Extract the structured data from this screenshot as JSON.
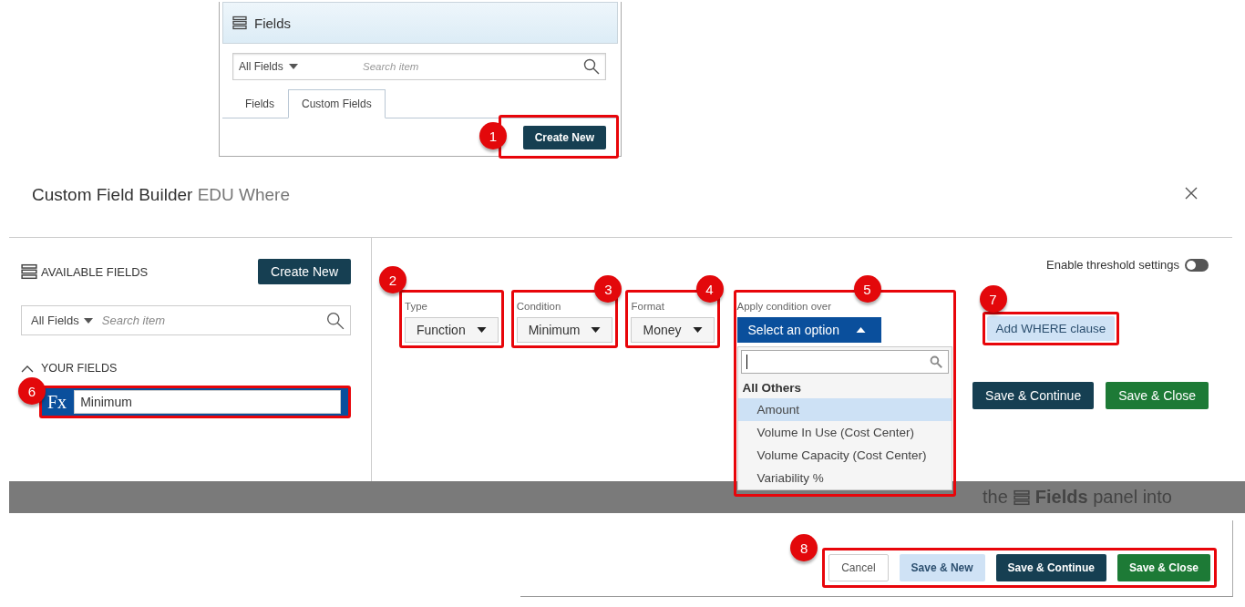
{
  "fields_panel": {
    "title": "Fields",
    "filter": "All Fields",
    "search_placeholder": "Search item",
    "tabs": [
      {
        "label": "Fields",
        "selected": false
      },
      {
        "label": "Custom Fields",
        "selected": true
      }
    ],
    "create_button": "Create New",
    "callout": "1"
  },
  "dialog": {
    "title": "Custom Field Builder",
    "subtitle": "EDU Where",
    "available_fields": {
      "heading": "AVAILABLE FIELDS",
      "create_button": "Create New",
      "filter": "All Fields",
      "search_placeholder": "Search item",
      "group": {
        "label": "YOUR FIELDS",
        "expanded": true
      },
      "item": {
        "badge": "Fx",
        "value": "Minimum",
        "callout": "6"
      }
    },
    "threshold": {
      "label": "Enable threshold settings",
      "on": false
    },
    "selects": [
      {
        "label": "Type",
        "value": "Function",
        "callout": "2"
      },
      {
        "label": "Condition",
        "value": "Minimum",
        "callout": "3"
      },
      {
        "label": "Format",
        "value": "Money",
        "callout": "4"
      }
    ],
    "apply": {
      "label": "Apply condition over",
      "value": "Select an option",
      "expanded": true,
      "callout": "5",
      "group": "All Others",
      "options": [
        {
          "label": "Amount",
          "selected": true
        },
        {
          "label": "Volume In Use (Cost Center)",
          "selected": false
        },
        {
          "label": "Volume Capacity (Cost Center)",
          "selected": false
        },
        {
          "label": "Variability %",
          "selected": false
        }
      ]
    },
    "where_button": {
      "label": "Add WHERE clause",
      "callout": "7"
    },
    "buttons": [
      {
        "label": "Save & Continue",
        "kind": "primary"
      },
      {
        "label": "Save & Close",
        "kind": "success"
      }
    ]
  },
  "background_text": {
    "before": "the",
    "after": "**Fields** panel into"
  },
  "footer": {
    "callout": "8",
    "buttons": [
      {
        "label": "Cancel",
        "kind": "default"
      },
      {
        "label": "Save & New",
        "kind": "light"
      },
      {
        "label": "Save & Continue",
        "kind": "primary"
      },
      {
        "label": "Save & Close",
        "kind": "success"
      }
    ]
  }
}
